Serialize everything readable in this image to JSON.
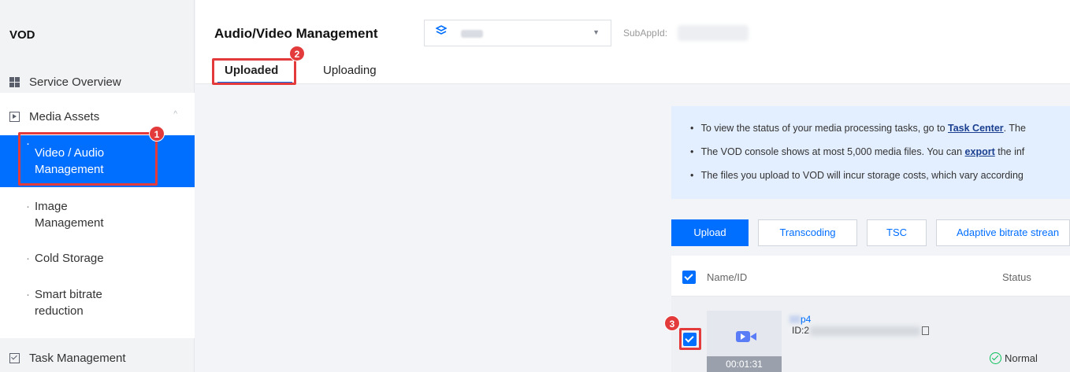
{
  "sidebar": {
    "brand": "VOD",
    "items": [
      {
        "label": "Service Overview",
        "icon": "grid-icon"
      },
      {
        "label": "Media Assets",
        "icon": "media-icon"
      }
    ],
    "sub_items": [
      {
        "label": "Video / Audio Management",
        "active": true
      },
      {
        "label": "Image Management"
      },
      {
        "label": "Cold Storage"
      },
      {
        "label": "Smart bitrate reduction"
      }
    ],
    "task_item": {
      "label": "Task Management",
      "icon": "checkbox-icon"
    }
  },
  "header": {
    "title": "Audio/Video Management",
    "subapp_label": "SubAppId:",
    "tabs": [
      {
        "label": "Uploaded",
        "active": true
      },
      {
        "label": "Uploading"
      }
    ]
  },
  "badges": [
    "1",
    "2",
    "3"
  ],
  "notice": {
    "line1_prefix": "To view the status of your media processing tasks, go to ",
    "line1_link": "Task Center",
    "line1_suffix": ". The",
    "line2_prefix": "The VOD console shows at most 5,000 media files. You can ",
    "line2_link": "export",
    "line2_suffix": " the inf",
    "line3": "The files you upload to VOD will incur storage costs, which vary according"
  },
  "toolbar": {
    "upload": "Upload",
    "transcoding": "Transcoding",
    "tsc": "TSC",
    "adaptive": "Adaptive bitrate strean"
  },
  "table": {
    "col_name": "Name/ID",
    "col_status": "Status",
    "rows": [
      {
        "name_suffix": "p4",
        "id_prefix": "ID:2",
        "duration": "00:01:31",
        "status": "Normal"
      }
    ]
  },
  "colors": {
    "accent": "#006eff",
    "annotation": "#e33b3b",
    "ok": "#0abf5b"
  }
}
